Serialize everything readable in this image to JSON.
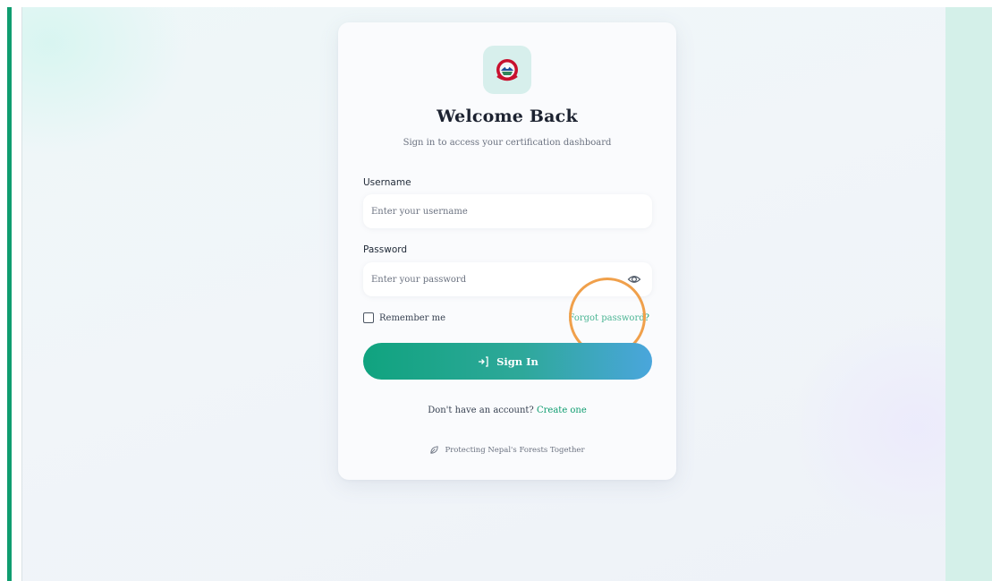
{
  "login": {
    "emblem_icon": "nepal-emblem-icon",
    "title": "Welcome Back",
    "subtitle": "Sign in to access your certification dashboard",
    "username": {
      "label": "Username",
      "placeholder": "Enter your username",
      "value": ""
    },
    "password": {
      "label": "Password",
      "placeholder": "Enter your password",
      "value": "",
      "toggle_icon": "eye-icon"
    },
    "remember_label": "Remember me",
    "remember_checked": false,
    "forgot_label": "Forgot password?",
    "signin_icon": "sign-in-icon",
    "signin_label": "Sign In",
    "signup_prompt": "Don't have an account?",
    "signup_link": "Create one",
    "footer_icon": "leaf-icon",
    "footer_text": "Protecting Nepal's Forests Together"
  },
  "colors": {
    "accent": "#0f9d70",
    "button_gradient_start": "#10a37f",
    "button_gradient_end": "#4aa6dc",
    "highlight_ring": "#f0a04b",
    "right_panel": "#d4f0e9"
  }
}
